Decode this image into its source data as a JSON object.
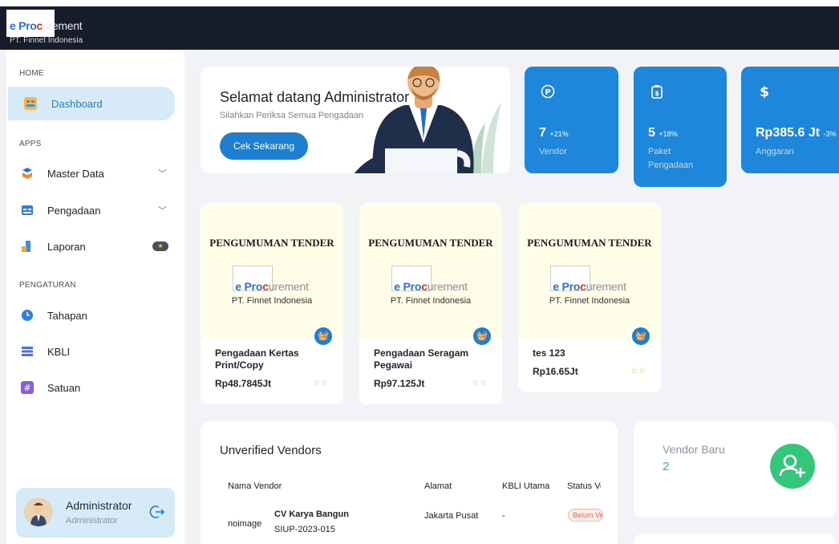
{
  "app": {
    "logo_e": "e",
    "logo_pro": "Pro",
    "logo_c": "c",
    "logo_rest": "urement",
    "company": "PT. Finnet Indonesia"
  },
  "sidebar": {
    "sections": {
      "home": "HOME",
      "apps": "APPS",
      "settings": "PENGATURAN"
    },
    "items": [
      {
        "label": "Dashboard",
        "icon": "dashboard-icon",
        "active": true
      },
      {
        "label": "Master Data",
        "icon": "master-data-icon",
        "expandable": true
      },
      {
        "label": "Pengadaan",
        "icon": "procurement-icon",
        "expandable": true
      },
      {
        "label": "Laporan",
        "icon": "report-icon",
        "badge": "star"
      },
      {
        "label": "Tahapan",
        "icon": "clock-icon"
      },
      {
        "label": "KBLI",
        "icon": "list-icon"
      },
      {
        "label": "Satuan",
        "icon": "hash-icon"
      }
    ],
    "user": {
      "name": "Administrator",
      "role": "Administrator"
    }
  },
  "welcome": {
    "title": "Selamat datang Administrator",
    "subtitle": "Silahkan Periksa Semua Pengadaan",
    "button": "Cek Sekarang"
  },
  "stats": [
    {
      "icon": "p-coin-icon",
      "value": "7",
      "change": "+21%",
      "label": "Vendor"
    },
    {
      "icon": "clipboard-dollar-icon",
      "value": "5",
      "change": "+18%",
      "label1": "Paket",
      "label2": "Pengadaan"
    },
    {
      "icon": "dollar-icon",
      "value": "Rp385.6 Jt",
      "change": "-3%",
      "label": "Anggaran"
    }
  ],
  "tenders": [
    {
      "header": "PENGUMUMAN TENDER",
      "line1": "Pengadaan Kertas",
      "line2": "Print/Copy",
      "price": "Rp48.7845Jt"
    },
    {
      "header": "PENGUMUMAN TENDER",
      "line1": "Pengadaan Seragam",
      "line2": "Pegawai",
      "price": "Rp97.125Jt"
    },
    {
      "header": "PENGUMUMAN TENDER",
      "line1": "tes 123",
      "line2": "",
      "price": "Rp16.65Jt"
    }
  ],
  "vendors_table": {
    "title": "Unverified Vendors",
    "columns": [
      "Nama Vendor",
      "Alamat",
      "KBLI Utama",
      "Status Verifikasi"
    ],
    "rows": [
      {
        "image": "noimage",
        "name": "CV Karya Bangun",
        "permit": "SIUP-2023-015",
        "address": "Jakarta Pusat",
        "kbli": "-",
        "status": "Belum Verifikasi"
      }
    ]
  },
  "vendor_baru": {
    "label": "Vendor Baru",
    "value": "2"
  },
  "colors": {
    "primary": "#1e87db",
    "topbar": "#161c2a",
    "success": "#34c77b",
    "active_bg": "#d6ebf7"
  }
}
